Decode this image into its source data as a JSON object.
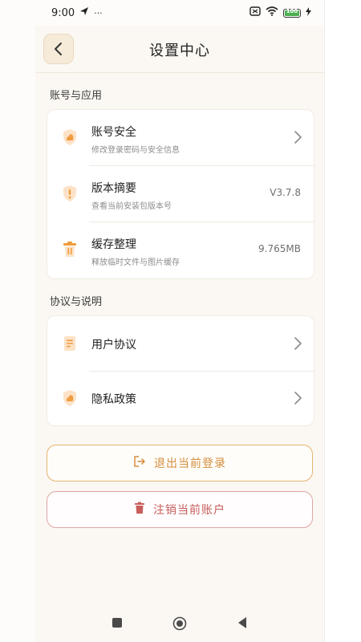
{
  "status_bar": {
    "time": "9:00",
    "battery": "100"
  },
  "header": {
    "title": "设置中心"
  },
  "section_account": {
    "label": "账号与应用",
    "items": [
      {
        "title": "账号安全",
        "subtitle": "修改登录密码与安全信息",
        "value": "",
        "icon": "shield-icon"
      },
      {
        "title": "版本摘要",
        "subtitle": "查看当前安装包版本号",
        "value": "V3.7.8",
        "icon": "alert-shield-icon"
      },
      {
        "title": "缓存整理",
        "subtitle": "释放临时文件与图片缓存",
        "value": "9.765MB",
        "icon": "trash-icon"
      }
    ]
  },
  "section_agreement": {
    "label": "协议与说明",
    "items": [
      {
        "title": "用户协议",
        "icon": "document-icon"
      },
      {
        "title": "隐私政策",
        "icon": "shield-icon"
      }
    ]
  },
  "buttons": {
    "logout": "退出当前登录",
    "cancel_account": "注销当前账户"
  },
  "colors": {
    "accent": "#f2a14a",
    "danger": "#c95c5c",
    "background": "#fbf8f3"
  }
}
